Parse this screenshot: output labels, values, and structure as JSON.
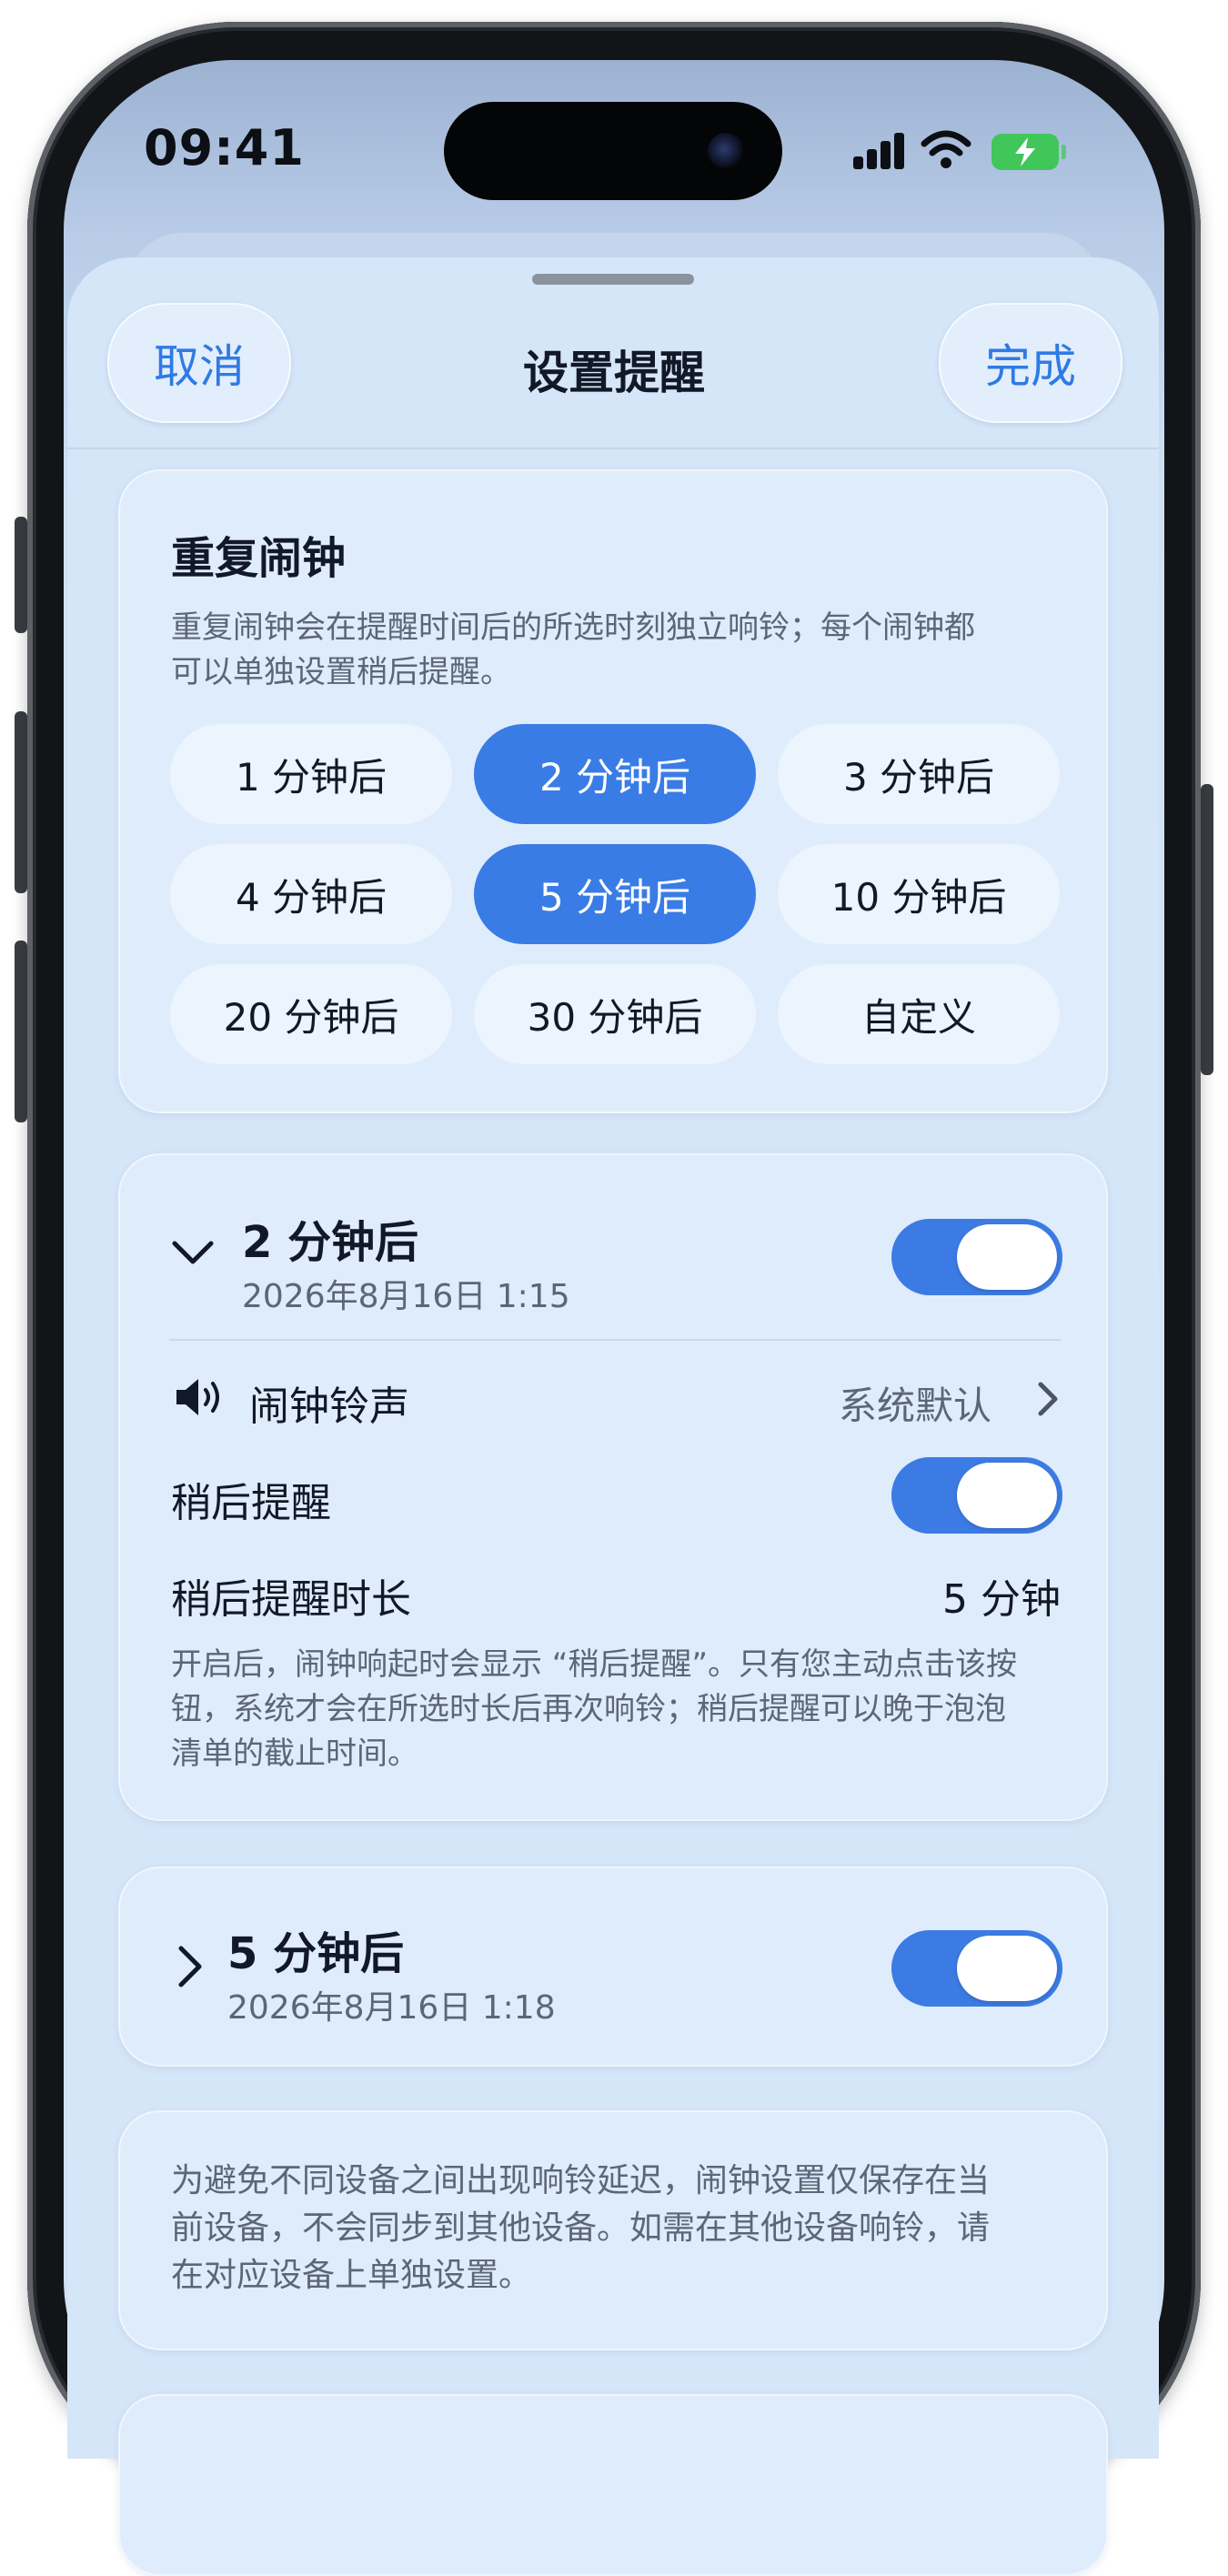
{
  "status_bar": {
    "time": "09:41",
    "icons": [
      "signal-icon",
      "wifi-icon",
      "battery-charging-icon"
    ]
  },
  "nav": {
    "cancel_label": "取消",
    "title": "设置提醒",
    "done_label": "完成"
  },
  "repeat_card": {
    "title": "重复闹钟",
    "description_line1": "重复闹钟会在提醒时间后的所选时刻独立响铃；每个闹钟都",
    "description_line2": "可以单独设置稍后提醒。",
    "chips": [
      {
        "label": "1 分钟后",
        "selected": false
      },
      {
        "label": "2 分钟后",
        "selected": true
      },
      {
        "label": "3 分钟后",
        "selected": false
      },
      {
        "label": "4 分钟后",
        "selected": false
      },
      {
        "label": "5 分钟后",
        "selected": true
      },
      {
        "label": "10 分钟后",
        "selected": false
      },
      {
        "label": "20 分钟后",
        "selected": false
      },
      {
        "label": "30 分钟后",
        "selected": false
      },
      {
        "label": "自定义",
        "selected": false
      }
    ]
  },
  "alarm1": {
    "title": "2 分钟后",
    "datetime": "2026年8月16日 1:15",
    "enabled": true,
    "expanded": true,
    "ringtone_label": "闹钟铃声",
    "ringtone_value": "系统默认",
    "snooze_label": "稍后提醒",
    "snooze_enabled": true,
    "snooze_duration_label": "稍后提醒时长",
    "snooze_duration_value": "5 分钟",
    "note_line1": "开启后，闹钟响起时会显示 “稍后提醒”。只有您主动点击该按",
    "note_line2": "钮，系统才会在所选时长后再次响铃；稍后提醒可以晚于泡泡",
    "note_line3": "清单的截止时间。"
  },
  "alarm2": {
    "title": "5 分钟后",
    "datetime": "2026年8月16日 1:18",
    "enabled": true,
    "expanded": false
  },
  "info_card": {
    "line1": "为避免不同设备之间出现响铃延迟，闹钟设置仅保存在当",
    "line2": "前设备，不会同步到其他设备。如需在其他设备响铃，请",
    "line3": "在对应设备上单独设置。"
  },
  "colors": {
    "accent": "#3a7ce6",
    "text": "#111827",
    "secondary": "#5b6676",
    "background": "#d6e6f9"
  }
}
